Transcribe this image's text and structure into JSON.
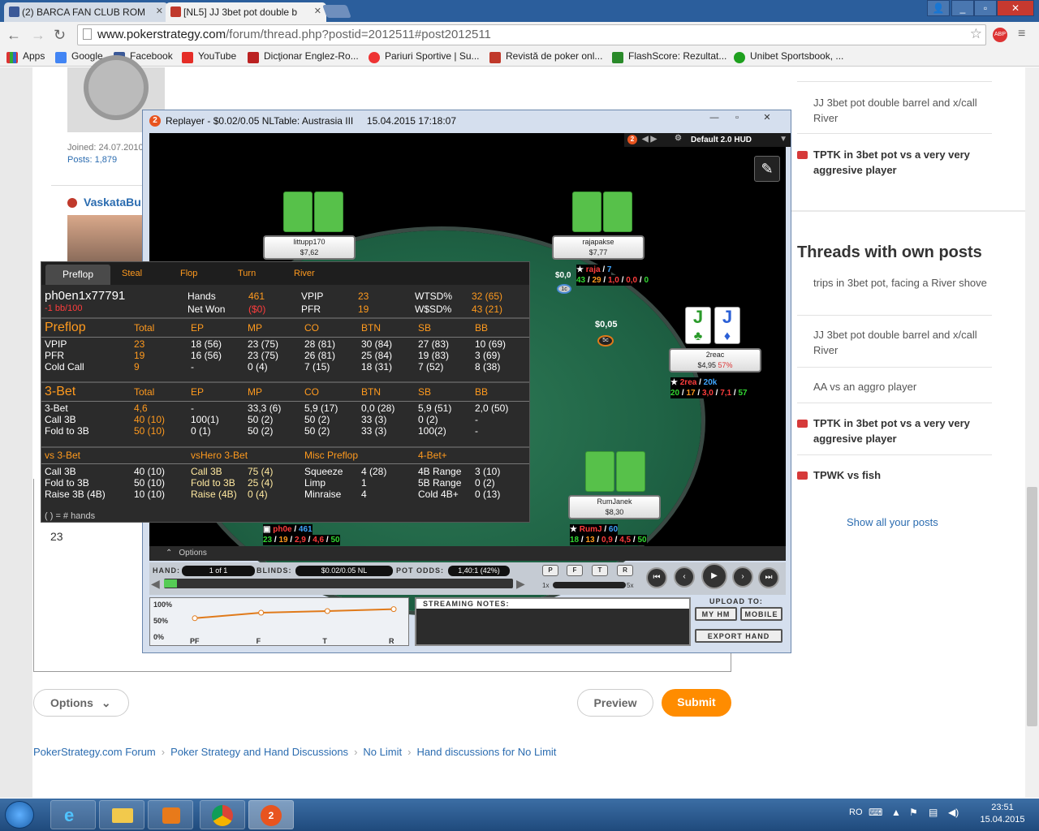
{
  "browser": {
    "tabs": [
      {
        "title": "(2) BARCA FAN CLUB ROM"
      },
      {
        "title": "[NL5] JJ 3bet pot double b"
      }
    ],
    "url_domain": "www.pokerstrategy.com",
    "url_path": "/forum/thread.php?postid=2012511#post2012511",
    "bookmarks": [
      "Apps",
      "Google",
      "Facebook",
      "YouTube",
      "Dicţionar Englez-Ro...",
      "Pariuri Sportive | Su...",
      "Revistă de poker onl...",
      "FlashScore: Rezultat...",
      "Unibet Sportsbook, ..."
    ]
  },
  "post": {
    "joined": "Joined: 24.07.2010",
    "posts": "Posts: 1,879",
    "author": "VaskataBu",
    "body_value": "23"
  },
  "form": {
    "options_label": "Options",
    "preview_label": "Preview",
    "submit_label": "Submit"
  },
  "breadcrumb": [
    "PokerStrategy.com Forum",
    "Poker Strategy and Hand Discussions",
    "No Limit",
    "Hand discussions for No Limit"
  ],
  "sidebar": {
    "items_top": [
      {
        "text": "JJ 3bet pot double barrel and x/call River",
        "bold": false
      },
      {
        "text": "TPTK in 3bet pot vs a very very aggresive player",
        "bold": true
      }
    ],
    "own_title": "Threads with own posts",
    "own_items": [
      {
        "text": "trips in 3bet pot, facing a River shove",
        "bold": false
      },
      {
        "text": "JJ 3bet pot double barrel and x/call River",
        "bold": false
      },
      {
        "text": "AA vs an aggro player",
        "bold": false
      },
      {
        "text": "TPTK in 3bet pot vs a very very aggresive player",
        "bold": true
      },
      {
        "text": "TPWK vs fish",
        "bold": true
      }
    ],
    "show_all": "Show all your posts"
  },
  "replayer": {
    "title": "Replayer - $0.02/0.05 NLTable: Austrasia III     15.04.2015 17:18:07",
    "hud_name": "Default 2.0 HUD",
    "options": "Options",
    "hand_label": "HAND:",
    "hand_value": "1 of 1",
    "blinds_label": "BLINDS:",
    "blinds_value": "$0.02/0.05 NL",
    "pot_odds_label": "POT ODDS:",
    "pot_odds_value": "1,40:1 (42%)",
    "filter_buttons": [
      "P",
      "F",
      "T",
      "R"
    ],
    "speed_min": "1x",
    "speed_max": "5x",
    "streaming_notes": "STREAMING NOTES:",
    "upload_to": "UPLOAD TO:",
    "my_hm": "MY HM",
    "mobile": "MOBILE",
    "export": "EXPORT HAND",
    "pot": "$0,05",
    "chip_5c": "5c",
    "chip_1c": "1c",
    "players": [
      {
        "name": "littupp170",
        "stack": "$7,62"
      },
      {
        "name": "rajapakse",
        "stack": "$7,77",
        "bet": "$0,0",
        "hud_name": "raja",
        "hud_hands": "7",
        "hud_stats": [
          "43",
          "29",
          "1,0",
          "0,0",
          "0"
        ]
      },
      {
        "name": "2reac",
        "stack": "$4,95",
        "pct": "57%",
        "hud_name": "2rea",
        "hud_hands": "20k",
        "hud_stats": [
          "20",
          "17",
          "3,0",
          "7,1",
          "57"
        ],
        "hole": [
          "J",
          "J"
        ]
      },
      {
        "name": "RumJanek",
        "stack": "$8,30",
        "hud_name": "RumJ",
        "hud_hands": "60",
        "hud_stats": [
          "18",
          "13",
          "0,9",
          "4,5",
          "50"
        ]
      },
      {
        "name": "ph0e",
        "hud_hands": "461",
        "hud_stats": [
          "23",
          "19",
          "2,9",
          "4,6",
          "50"
        ]
      }
    ],
    "chart": {
      "y_ticks": [
        "100%",
        "50%",
        "0%"
      ],
      "x_ticks": [
        "PF",
        "F",
        "T",
        "R"
      ]
    }
  },
  "chart_data": {
    "type": "line",
    "categories": [
      "PF",
      "F",
      "T",
      "R"
    ],
    "series": [
      {
        "values": [
          58,
          75,
          80,
          86
        ]
      }
    ],
    "ylim": [
      0,
      100
    ]
  },
  "stats": {
    "tabs": [
      "Preflop",
      "Steal",
      "Flop",
      "Turn",
      "River"
    ],
    "player": "ph0en1x77791",
    "winrate": "-1 bb/100",
    "summary": [
      [
        "Hands",
        "461"
      ],
      [
        "Net Won",
        "($0)"
      ],
      [
        "VPIP",
        "23"
      ],
      [
        "PFR",
        "19"
      ],
      [
        "WTSD%",
        "32 (65)"
      ],
      [
        "W$SD%",
        "43 (21)"
      ]
    ],
    "preflop": {
      "title": "Preflop",
      "cols": [
        "Total",
        "EP",
        "MP",
        "CO",
        "BTN",
        "SB",
        "BB"
      ],
      "rows": [
        [
          "VPIP",
          "23",
          "18 (56)",
          "23 (75)",
          "28 (81)",
          "30 (84)",
          "27 (83)",
          "10 (69)"
        ],
        [
          "PFR",
          "19",
          "16 (56)",
          "23 (75)",
          "26 (81)",
          "25 (84)",
          "19 (83)",
          "3 (69)"
        ],
        [
          "Cold Call",
          "9",
          "-",
          "0 (4)",
          "7 (15)",
          "18 (31)",
          "7 (52)",
          "8 (38)"
        ]
      ]
    },
    "threebet": {
      "title": "3-Bet",
      "cols": [
        "Total",
        "EP",
        "MP",
        "CO",
        "BTN",
        "SB",
        "BB"
      ],
      "rows": [
        [
          "3-Bet",
          "4,6",
          "-",
          "33,3 (6)",
          "5,9 (17)",
          "0,0 (28)",
          "5,9 (51)",
          "2,0 (50)"
        ],
        [
          "Call 3B",
          "40 (10)",
          "100(1)",
          "50 (2)",
          "50 (2)",
          "33 (3)",
          "0 (2)",
          "-"
        ],
        [
          "Fold to 3B",
          "50 (10)",
          "0 (1)",
          "50 (2)",
          "50 (2)",
          "33 (3)",
          "100(2)",
          "-"
        ]
      ]
    },
    "misc": {
      "headers": [
        "vs 3-Bet",
        "vsHero 3-Bet",
        "Misc Preflop",
        "4-Bet+"
      ],
      "rows": [
        [
          "Call 3B",
          "40 (10)",
          "Call 3B",
          "75 (4)",
          "Squeeze",
          "4 (28)",
          "4B Range",
          "3 (10)"
        ],
        [
          "Fold to 3B",
          "50 (10)",
          "Fold to 3B",
          "25 (4)",
          "Limp",
          "1",
          "5B Range",
          "0 (2)"
        ],
        [
          "Raise 3B (4B)",
          "10 (10)",
          "Raise (4B)",
          "0 (4)",
          "Minraise",
          "4",
          "Cold 4B+",
          "0 (13)"
        ]
      ]
    },
    "footnote": "( ) = # hands"
  },
  "taskbar": {
    "lang": "RO",
    "time": "23:51",
    "date": "15.04.2015"
  },
  "colors": {
    "accent": "#ff9a1e",
    "link": "#2b6cb0",
    "submit": "#ff8c00"
  }
}
